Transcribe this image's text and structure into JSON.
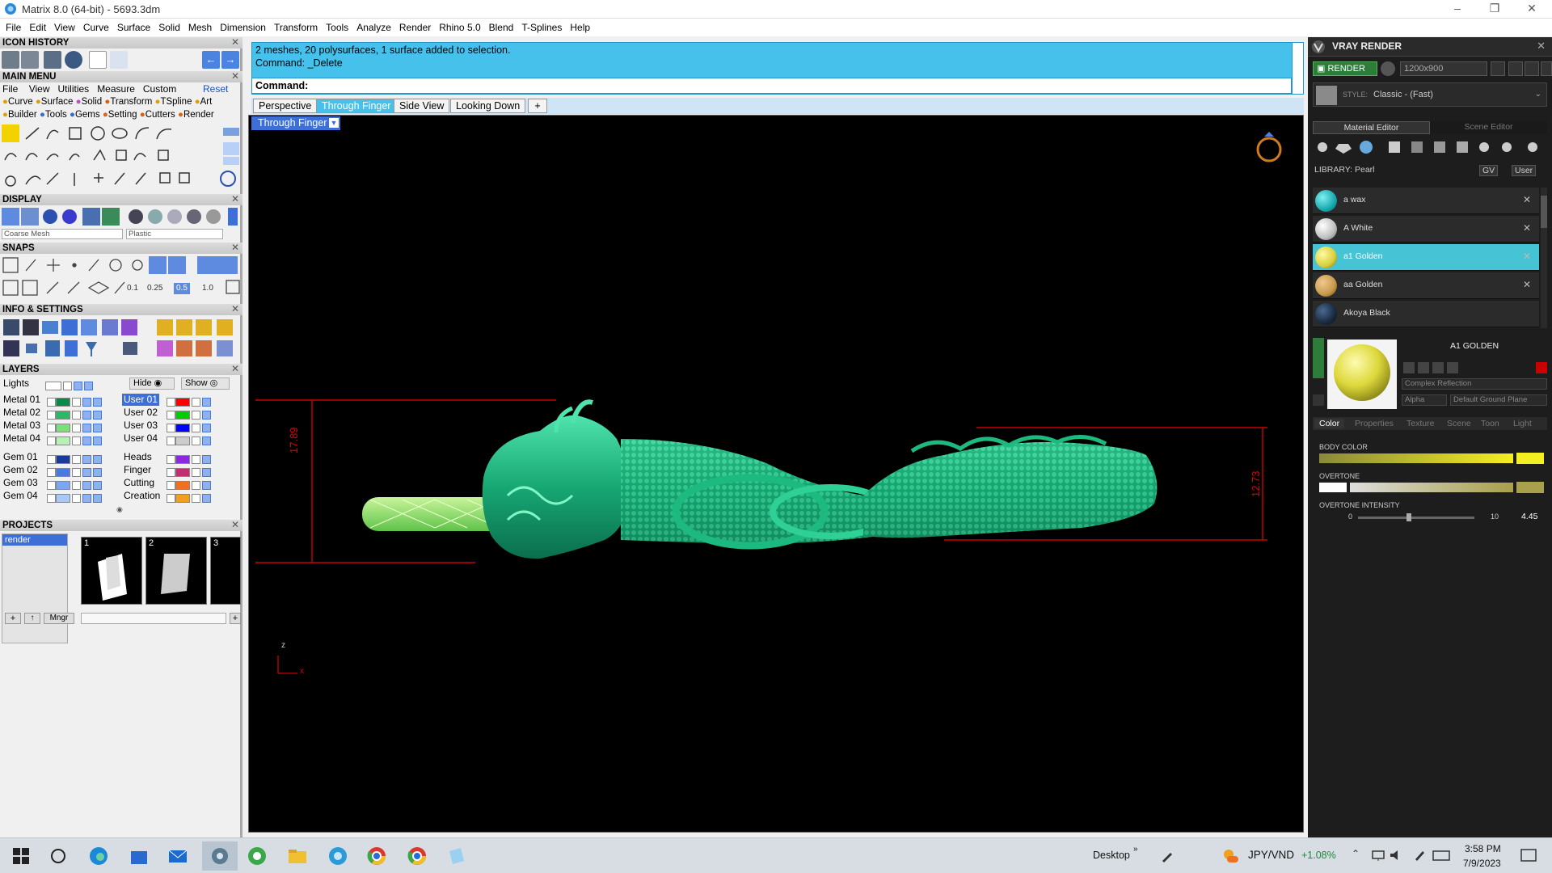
{
  "window": {
    "title": "Matrix 8.0 (64-bit) - 5693.3dm",
    "minimize": "–",
    "maximize": "❐",
    "close": "✕"
  },
  "menu": [
    "File",
    "Edit",
    "View",
    "Curve",
    "Surface",
    "Solid",
    "Mesh",
    "Dimension",
    "Transform",
    "Tools",
    "Analyze",
    "Render",
    "Rhino 5.0",
    "Blend",
    "T-Splines",
    "Help"
  ],
  "left": {
    "icon_history": "ICON HISTORY",
    "main_menu": "MAIN MENU",
    "main_menu_items": [
      "File",
      "View",
      "Utilities",
      "Measure",
      "Custom"
    ],
    "reset": "Reset",
    "main_cats_row1": [
      "Curve",
      "Surface",
      "Solid",
      "Transform",
      "TSpline",
      "Art"
    ],
    "main_cats_row2": [
      "Builder",
      "Tools",
      "Gems",
      "Setting",
      "Cutters",
      "Render"
    ],
    "display": "DISPLAY",
    "display_mesh": "Coarse Mesh",
    "display_mat": "Plastic",
    "snaps": "SNAPS",
    "snap_values": [
      "0.1",
      "0.25",
      "0.5",
      "1.0"
    ],
    "info_settings": "INFO & SETTINGS",
    "layers": "LAYERS",
    "lights": "Lights",
    "hide": "Hide",
    "show": "Show",
    "layers_col1": [
      "Metal 01",
      "Metal 02",
      "Metal 03",
      "Metal 04",
      "Gem 01",
      "Gem 02",
      "Gem 03",
      "Gem 04"
    ],
    "layers_col2": [
      "User 01",
      "User 02",
      "User 03",
      "User 04",
      "Heads",
      "Finger",
      "Cutting",
      "Creation"
    ],
    "projects": "PROJECTS",
    "project_item": "render",
    "project_nums": [
      "1",
      "2",
      "3"
    ],
    "mngr": "Mngr"
  },
  "command": {
    "line1": "2 meshes, 20 polysurfaces, 1 surface added to selection.",
    "line2": "Command: _Delete",
    "prompt": "Command:"
  },
  "viewport": {
    "tabs": [
      "Perspective",
      "Through Finger",
      "Side View",
      "Looking Down"
    ],
    "active_tab": "Through Finger",
    "label": "Through Finger",
    "dim_left": "17.89",
    "dim_right": "12.73",
    "axis_z": "z",
    "axis_x": "x"
  },
  "right": {
    "title": "VRAY RENDER",
    "render_btn": "RENDER",
    "resolution": "1200x900",
    "style_label": "STYLE:",
    "style_value": "Classic - (Fast)",
    "tab_material": "Material Editor",
    "tab_scene": "Scene Editor",
    "library": "LIBRARY: Pearl",
    "lib_btn1": "GV",
    "lib_btn2": "User",
    "materials": [
      {
        "name": "a wax",
        "color": "#19a9b0"
      },
      {
        "name": "A White",
        "color": "#bfbfbf"
      },
      {
        "name": "a1 Golden",
        "color": "#d6cf3a"
      },
      {
        "name": "aa Golden",
        "color": "#c79a4a"
      },
      {
        "name": "Akoya Black",
        "color": "#1a2a40"
      }
    ],
    "selected_material": "A1 GOLDEN",
    "reflection": "Complex Reflection",
    "alpha": "Alpha",
    "ground": "Default Ground Plane",
    "subtabs": [
      "Color",
      "Properties",
      "Texture",
      "Scene",
      "Toon",
      "Light"
    ],
    "body_color": "BODY COLOR",
    "overtone": "OVERTONE",
    "overtone_intensity": "OVERTONE INTENSITY",
    "intensity_min": "0",
    "intensity_max": "10",
    "intensity_value": "4.45"
  },
  "taskbar": {
    "desktop": "Desktop",
    "currency": "JPY/VND",
    "change": "+1.08%",
    "time": "3:58 PM",
    "date": "7/9/2023"
  }
}
